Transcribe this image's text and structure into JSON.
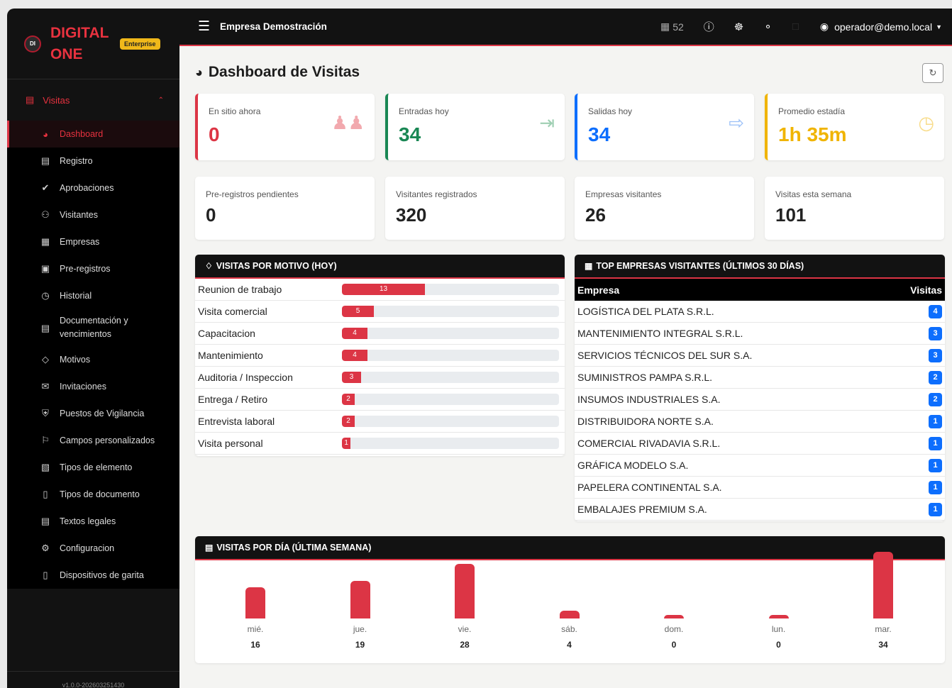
{
  "brand": {
    "logo_text": "DI",
    "name": "DIGITAL ONE",
    "badge": "Enterprise",
    "version": "v1.0.0-202603251430"
  },
  "sidebar": {
    "group_label": "Visitas",
    "items": [
      {
        "label": "Dashboard",
        "icon": "gauge-icon"
      },
      {
        "label": "Registro",
        "icon": "clipboard-icon"
      },
      {
        "label": "Aprobaciones",
        "icon": "check-all-icon"
      },
      {
        "label": "Visitantes",
        "icon": "people-icon"
      },
      {
        "label": "Empresas",
        "icon": "building-icon"
      },
      {
        "label": "Pre-registros",
        "icon": "calendar-check-icon"
      },
      {
        "label": "Historial",
        "icon": "clock-history-icon"
      },
      {
        "label": "Documentación y vencimientos",
        "icon": "clipboard-check-icon"
      },
      {
        "label": "Motivos",
        "icon": "tag-icon"
      },
      {
        "label": "Invitaciones",
        "icon": "envelope-open-icon"
      },
      {
        "label": "Puestos de Vigilancia",
        "icon": "shield-icon"
      },
      {
        "label": "Campos personalizados",
        "icon": "signpost-icon"
      },
      {
        "label": "Tipos de elemento",
        "icon": "box-icon"
      },
      {
        "label": "Tipos de documento",
        "icon": "file-icon"
      },
      {
        "label": "Textos legales",
        "icon": "file-text-icon"
      },
      {
        "label": "Configuracion",
        "icon": "gear-icon"
      },
      {
        "label": "Dispositivos de garita",
        "icon": "tablet-icon"
      }
    ]
  },
  "topbar": {
    "company": "Empresa Demostración",
    "counter": "52",
    "user": "operador@demo.local"
  },
  "page": {
    "title": "Dashboard de Visitas"
  },
  "stats": [
    {
      "label": "En sitio ahora",
      "value": "0",
      "color": "#dc3545"
    },
    {
      "label": "Entradas hoy",
      "value": "34",
      "color": "#198754"
    },
    {
      "label": "Salidas hoy",
      "value": "34",
      "color": "#0d6efd"
    },
    {
      "label": "Promedio estadía",
      "value": "1h 35m",
      "color": "#f0b400"
    }
  ],
  "stats_small": [
    {
      "label": "Pre-registros pendientes",
      "value": "0"
    },
    {
      "label": "Visitantes registrados",
      "value": "320"
    },
    {
      "label": "Empresas visitantes",
      "value": "26"
    },
    {
      "label": "Visitas esta semana",
      "value": "101"
    }
  ],
  "motivos": {
    "title": "VISITAS POR MOTIVO (HOY)",
    "max": 34,
    "rows": [
      {
        "name": "Reunion de trabajo",
        "value": 13
      },
      {
        "name": "Visita comercial",
        "value": 5
      },
      {
        "name": "Capacitacion",
        "value": 4
      },
      {
        "name": "Mantenimiento",
        "value": 4
      },
      {
        "name": "Auditoria / Inspeccion",
        "value": 3
      },
      {
        "name": "Entrega / Retiro",
        "value": 2
      },
      {
        "name": "Entrevista laboral",
        "value": 2
      },
      {
        "name": "Visita personal",
        "value": 1
      }
    ]
  },
  "empresas": {
    "title": "TOP EMPRESAS VISITANTES (ÚLTIMOS 30 DÍAS)",
    "col_empresa": "Empresa",
    "col_visitas": "Visitas",
    "rows": [
      {
        "name": "LOGÍSTICA DEL PLATA S.R.L.",
        "visits": "4"
      },
      {
        "name": "MANTENIMIENTO INTEGRAL S.R.L.",
        "visits": "3"
      },
      {
        "name": "SERVICIOS TÉCNICOS DEL SUR S.A.",
        "visits": "3"
      },
      {
        "name": "SUMINISTROS PAMPA S.R.L.",
        "visits": "2"
      },
      {
        "name": "INSUMOS INDUSTRIALES S.A.",
        "visits": "2"
      },
      {
        "name": "DISTRIBUIDORA NORTE S.A.",
        "visits": "1"
      },
      {
        "name": "COMERCIAL RIVADAVIA S.R.L.",
        "visits": "1"
      },
      {
        "name": "GRÁFICA MODELO S.A.",
        "visits": "1"
      },
      {
        "name": "PAPELERA CONTINENTAL S.A.",
        "visits": "1"
      },
      {
        "name": "EMBALAJES PREMIUM S.A.",
        "visits": "1"
      }
    ]
  },
  "chart_data": {
    "type": "bar",
    "title": "VISITAS POR DÍA (ÚLTIMA SEMANA)",
    "categories": [
      "mié.",
      "jue.",
      "vie.",
      "sáb.",
      "dom.",
      "lun.",
      "mar."
    ],
    "values": [
      16,
      19,
      28,
      4,
      0,
      0,
      34
    ],
    "color": "#dc3545"
  }
}
